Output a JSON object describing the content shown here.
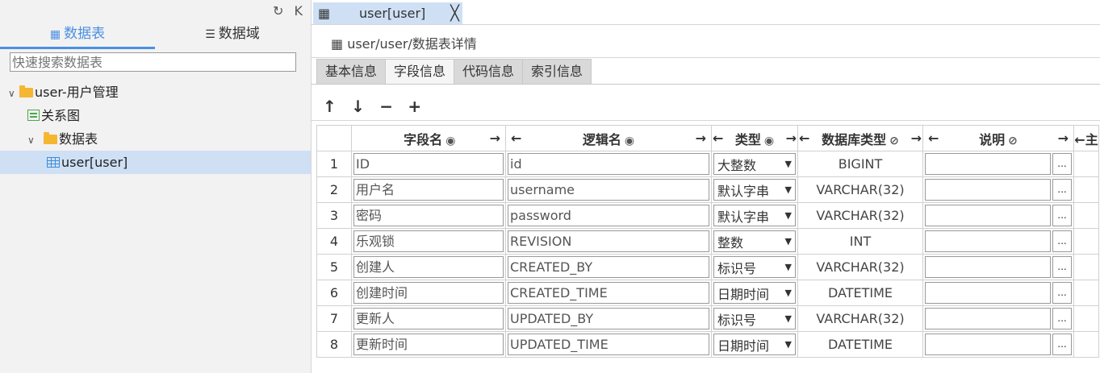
{
  "left_icons": {
    "refresh": "↻",
    "collapse": "K"
  },
  "left_tabs": [
    {
      "label": "数据表",
      "icon": "grid-icon",
      "active": true
    },
    {
      "label": "数据域",
      "icon": "list-icon",
      "active": false
    }
  ],
  "search": {
    "placeholder": "快速搜索数据表"
  },
  "tree": {
    "module": "user-用户管理",
    "relation": "关系图",
    "folder": "数据表",
    "table": "user[user]"
  },
  "doc_tab": {
    "title": "user[user]",
    "close": "╳"
  },
  "breadcrumb": "user/user/数据表详情",
  "sub_tabs": [
    "基本信息",
    "字段信息",
    "代码信息",
    "索引信息"
  ],
  "active_sub_tab": "字段信息",
  "toolbar": {
    "up": "↑",
    "down": "↓",
    "remove": "−",
    "add": "+"
  },
  "columns": {
    "field": "字段名",
    "logic": "逻辑名",
    "type": "类型",
    "dbtype": "数据库类型",
    "desc": "说明",
    "pk": "主"
  },
  "arrows": {
    "left": "←",
    "right": "→",
    "eye": "◉",
    "eye_off": "⊘"
  },
  "rows": [
    {
      "n": "1",
      "field": "ID",
      "logic": "id",
      "type": "大整数",
      "dbtype": "BIGINT"
    },
    {
      "n": "2",
      "field": "用户名",
      "logic": "username",
      "type": "默认字串",
      "dbtype": "VARCHAR(32)"
    },
    {
      "n": "3",
      "field": "密码",
      "logic": "password",
      "type": "默认字串",
      "dbtype": "VARCHAR(32)"
    },
    {
      "n": "4",
      "field": "乐观锁",
      "logic": "REVISION",
      "type": "整数",
      "dbtype": "INT"
    },
    {
      "n": "5",
      "field": "创建人",
      "logic": "CREATED_BY",
      "type": "标识号",
      "dbtype": "VARCHAR(32)"
    },
    {
      "n": "6",
      "field": "创建时间",
      "logic": "CREATED_TIME",
      "type": "日期时间",
      "dbtype": "DATETIME"
    },
    {
      "n": "7",
      "field": "更新人",
      "logic": "UPDATED_BY",
      "type": "标识号",
      "dbtype": "VARCHAR(32)"
    },
    {
      "n": "8",
      "field": "更新时间",
      "logic": "UPDATED_TIME",
      "type": "日期时间",
      "dbtype": "DATETIME"
    }
  ],
  "colors": {
    "accent": "#4a90e2",
    "selected_bg": "#cfe0f5",
    "folder": "#f5b731"
  }
}
